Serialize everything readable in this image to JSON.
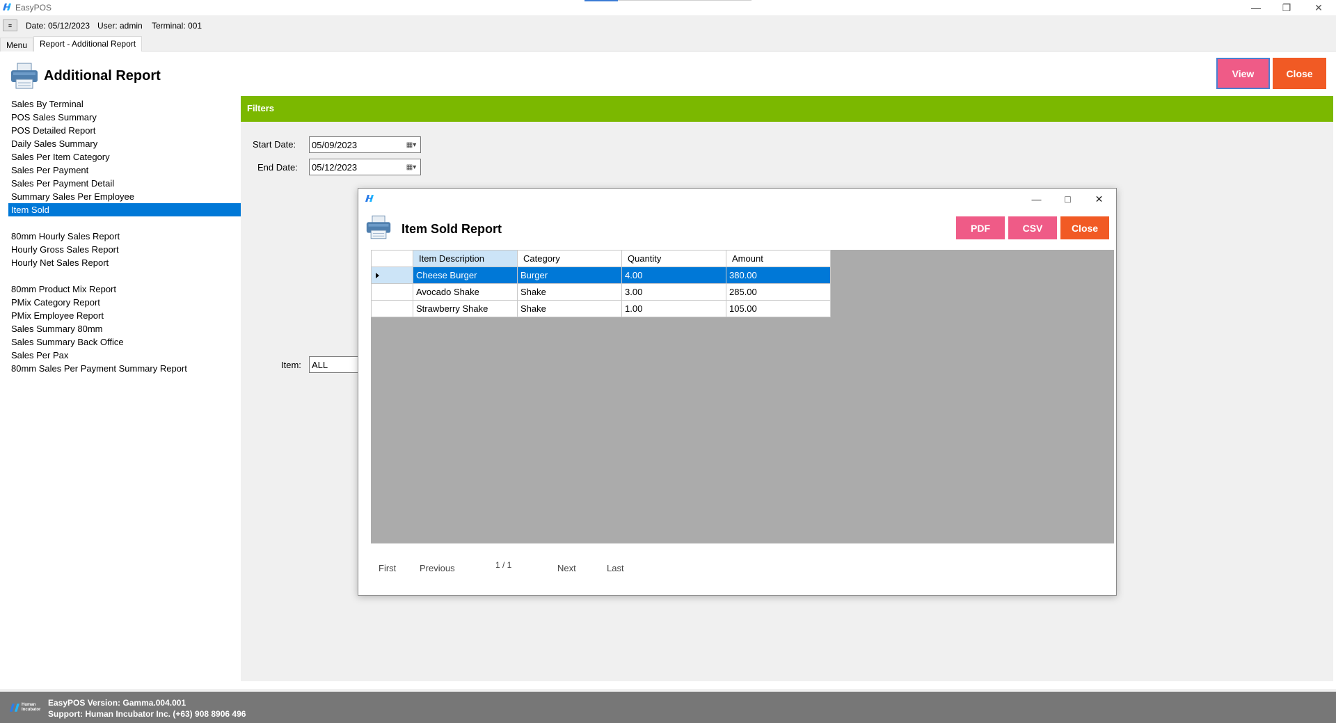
{
  "window": {
    "app_title": "EasyPOS",
    "minimize_icon": "minimize-icon",
    "restore_icon": "restore-icon",
    "close_icon": "close-icon"
  },
  "status": {
    "date": "Date: 05/12/2023",
    "user": "User: admin",
    "terminal": "Terminal: 001"
  },
  "tabs": [
    {
      "label": "Menu"
    },
    {
      "label": "Report - Additional Report"
    }
  ],
  "header": {
    "title": "Additional Report",
    "view_label": "View",
    "close_label": "Close"
  },
  "reports": {
    "group1": [
      "Sales By Terminal",
      "POS Sales Summary",
      "POS Detailed Report",
      "Daily Sales Summary",
      "Sales Per Item Category",
      "Sales Per Payment",
      "Sales Per Payment Detail",
      "Summary Sales Per Employee",
      "Item Sold"
    ],
    "group2": [
      "80mm Hourly Sales Report",
      "Hourly Gross Sales Report",
      "Hourly Net Sales Report"
    ],
    "group3": [
      "80mm Product Mix Report",
      "PMix Category Report",
      "PMix Employee Report",
      "Sales Summary 80mm",
      "Sales Summary Back Office",
      "Sales Per Pax",
      "80mm Sales Per Payment Summary Report"
    ],
    "selected": "Item Sold"
  },
  "filters": {
    "title": "Filters",
    "start_label": "Start Date:",
    "start_value": "05/09/2023",
    "end_label": "End Date:",
    "end_value": "05/12/2023",
    "item_label": "Item:",
    "item_value": "ALL"
  },
  "dialog": {
    "title": "Item Sold Report",
    "pdf_label": "PDF",
    "csv_label": "CSV",
    "close_label": "Close",
    "columns": [
      "Item Description",
      "Category",
      "Quantity",
      "Amount"
    ],
    "rows": [
      [
        "Cheese Burger",
        "Burger",
        "4.00",
        "380.00"
      ],
      [
        "Avocado Shake",
        "Shake",
        "3.00",
        "285.00"
      ],
      [
        "Strawberry Shake",
        "Shake",
        "1.00",
        "105.00"
      ]
    ],
    "pager": {
      "first": "First",
      "previous": "Previous",
      "page": "1 / 1",
      "next": "Next",
      "last": "Last"
    }
  },
  "footer": {
    "version": "EasyPOS Version: Gamma.004.001",
    "support": "Support: Human Incubator Inc. (+63) 908 8906 496",
    "logo_text": "Human Incubator"
  },
  "colors": {
    "accent_pink": "#ef5b87",
    "accent_orange": "#f15a24",
    "filters_green": "#7bb800",
    "selection_blue": "#0078d7",
    "footer_gray": "#777777"
  }
}
